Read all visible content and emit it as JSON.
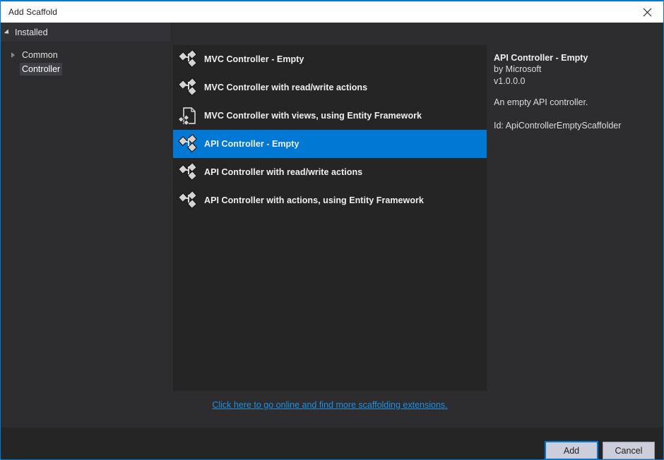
{
  "window": {
    "title": "Add Scaffold",
    "close_icon": "close-icon"
  },
  "sidebar": {
    "header": {
      "label": "Installed",
      "expander_icon": "triangle-down-icon"
    },
    "tree": [
      {
        "label": "Common",
        "expander_icon": "triangle-right-icon",
        "selected": false
      },
      {
        "label": "Controller",
        "expander_icon": "none",
        "selected": true
      }
    ]
  },
  "list": {
    "items": [
      {
        "label": "MVC Controller - Empty",
        "icon": "controller-scaffold-icon",
        "selected": false
      },
      {
        "label": "MVC Controller with read/write actions",
        "icon": "controller-scaffold-icon",
        "selected": false
      },
      {
        "label": "MVC Controller with views, using Entity Framework",
        "icon": "page-controller-scaffold-icon",
        "selected": false
      },
      {
        "label": "API Controller - Empty",
        "icon": "controller-scaffold-icon",
        "selected": true
      },
      {
        "label": "API Controller with read/write actions",
        "icon": "controller-scaffold-icon",
        "selected": false
      },
      {
        "label": "API Controller with actions, using Entity Framework",
        "icon": "controller-scaffold-icon",
        "selected": false
      }
    ]
  },
  "details": {
    "title": "API Controller - Empty",
    "author": "by Microsoft",
    "version": "v1.0.0.0",
    "description": "An empty API controller.",
    "id": "Id: ApiControllerEmptyScaffolder"
  },
  "link": {
    "text": "Click here to go online and find more scaffolding extensions."
  },
  "footer": {
    "add_label": "Add",
    "cancel_label": "Cancel"
  },
  "colors": {
    "accent": "#007acc",
    "selection": "#0078d4",
    "link": "#1e90e0",
    "dialog_bg": "#2d2d30",
    "list_bg": "#252526",
    "header_bg": "#333337",
    "tree_selection": "#3f3f46",
    "titlebar_bg": "#ffffff",
    "button_bg": "#cccedb"
  }
}
